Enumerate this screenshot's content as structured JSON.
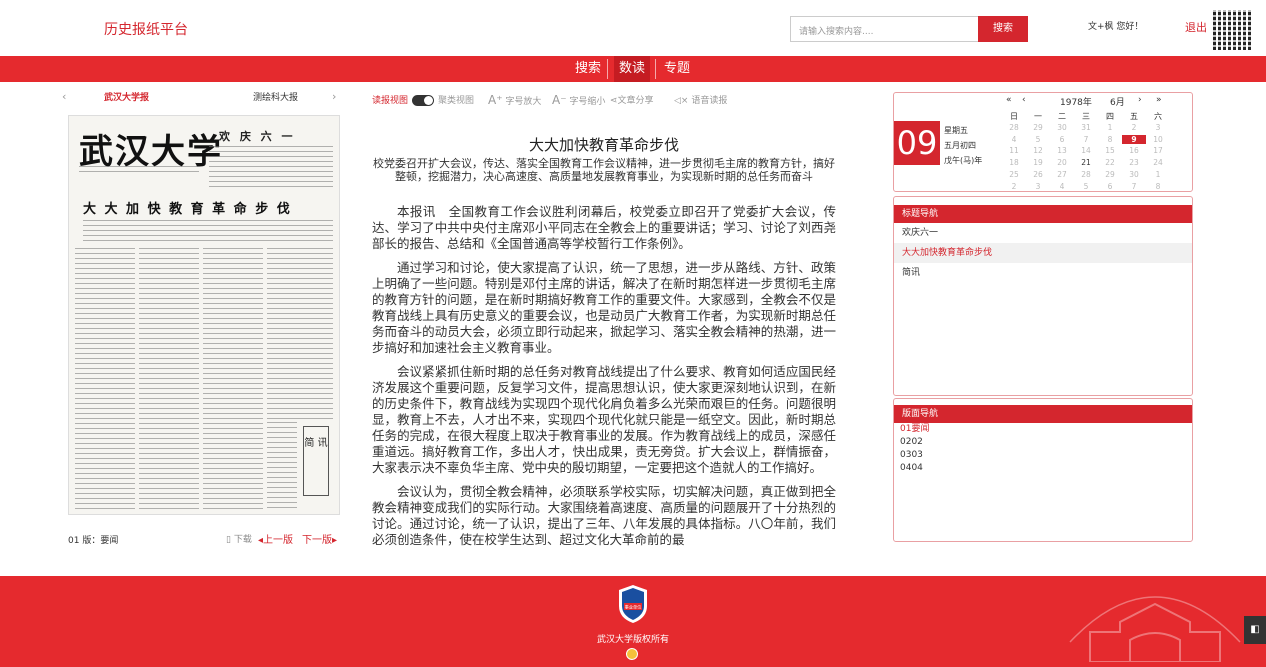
{
  "header": {
    "site_title": "历史报纸平台",
    "search_placeholder": "请输入搜索内容....",
    "search_button": "搜索",
    "greeting": "文+枫 您好！",
    "logout": "退出"
  },
  "nav": {
    "items": [
      {
        "label": "搜索"
      },
      {
        "label": "数读"
      },
      {
        "label": "专题"
      }
    ],
    "active_index": 1
  },
  "paper": {
    "current": "武汉大学报",
    "other": "测绘科大报",
    "masthead": "武汉大学",
    "section_banner": "欢 庆 六 一",
    "scan_headline": "大 大 加 快 教 育 革 命 步 伐",
    "box_text": "简 讯",
    "page_label": "01 版：要闻",
    "download": "下载",
    "prev": "上一版",
    "next": "下一版"
  },
  "toolbar": {
    "read_view": "读报视图",
    "cluster_view": "聚类视图",
    "font_up": "字号放大",
    "font_down": "字号缩小",
    "share": "文章分享",
    "speech": "语音读报"
  },
  "article": {
    "title": "大大加快教育革命步伐",
    "subtitle": "校党委召开扩大会议，传达、落实全国教育工作会议精神，进一步贯彻毛主席的教育方针，搞好整顿，挖掘潜力，决心高速度、高质量地发展教育事业，为实现新时期的总任务而奋斗",
    "paragraphs": [
      "本报讯　全国教育工作会议胜利闭幕后，校党委立即召开了党委扩大会议，传达、学习了中共中央付主席邓小平同志在全教会上的重要讲话；学习、讨论了刘西尧部长的报告、总结和《全国普通高等学校暂行工作条例》。",
      "通过学习和讨论，使大家提高了认识，统一了思想，进一步从路线、方针、政策上明确了一些问题。特别是邓付主席的讲话，解决了在新时期怎样进一步贯彻毛主席的教育方针的问题，是在新时期搞好教育工作的重要文件。大家感到，全教会不仅是教育战线上具有历史意义的重要会议，也是动员广大教育工作者，为实现新时期总任务而奋斗的动员大会，必须立即行动起来，掀起学习、落实全教会精神的热潮，进一步搞好和加速社会主义教育事业。",
      "会议紧紧抓住新时期的总任务对教育战线提出了什么要求、教育如何适应国民经济发展这个重要问题，反复学习文件，提高思想认识，使大家更深刻地认识到，在新的历史条件下，教育战线为实现四个现代化肩负着多么光荣而艰巨的任务。问题很明显，教育上不去，人才出不来，实现四个现代化就只能是一纸空文。因此，新时期总任务的完成，在很大程度上取决于教育事业的发展。作为教育战线上的成员，深感任重道远。搞好教育工作，多出人才，快出成果，责无旁贷。扩大会议上，群情振奋，大家表示决不辜负华主席、党中央的殷切期望，一定要把这个造就人的工作搞好。",
      "会议认为，贯彻全教会精神，必须联系学校实际，切实解决问题，真正做到把全教会精神变成我们的实际行动。大家围绕着高速度、高质量的问题展开了十分热烈的讨论。通过讨论，统一了认识，提出了三年、八年发展的具体指标。八〇年前，我们必须创造条件，使在校学生达到、超过文化大革命前的最"
    ]
  },
  "calendar": {
    "day": "09",
    "weekday": "星期五",
    "lunar": "五月初四",
    "ganzhi": "戊午(马)年",
    "year": "1978年",
    "month": "6月",
    "prev_year": "«",
    "prev_month": "‹",
    "next_month": "›",
    "next_year": "»",
    "weekdays": [
      "日",
      "一",
      "二",
      "三",
      "四",
      "五",
      "六"
    ],
    "weeks": [
      [
        "28",
        "29",
        "30",
        "31",
        "1",
        "2",
        "3"
      ],
      [
        "4",
        "5",
        "6",
        "7",
        "8",
        "9",
        "10"
      ],
      [
        "11",
        "12",
        "13",
        "14",
        "15",
        "16",
        "17"
      ],
      [
        "18",
        "19",
        "20",
        "21",
        "22",
        "23",
        "24"
      ],
      [
        "25",
        "26",
        "27",
        "28",
        "29",
        "30",
        "1"
      ],
      [
        "2",
        "3",
        "4",
        "5",
        "6",
        "7",
        "8"
      ]
    ]
  },
  "title_nav": {
    "heading": "标题导航",
    "items": [
      "欢庆六一",
      "大大加快教育革命步伐",
      "简讯"
    ],
    "active_index": 1
  },
  "page_nav": {
    "heading": "版面导航",
    "items": [
      "01要闻",
      "0202",
      "0303",
      "0404"
    ],
    "active_index": 0
  },
  "footer": {
    "emblem_text": "事业单位",
    "copyright": "武汉大学版权所有"
  },
  "colors": {
    "brand_red": "#e52a2e",
    "dark_red": "#d4262e"
  }
}
